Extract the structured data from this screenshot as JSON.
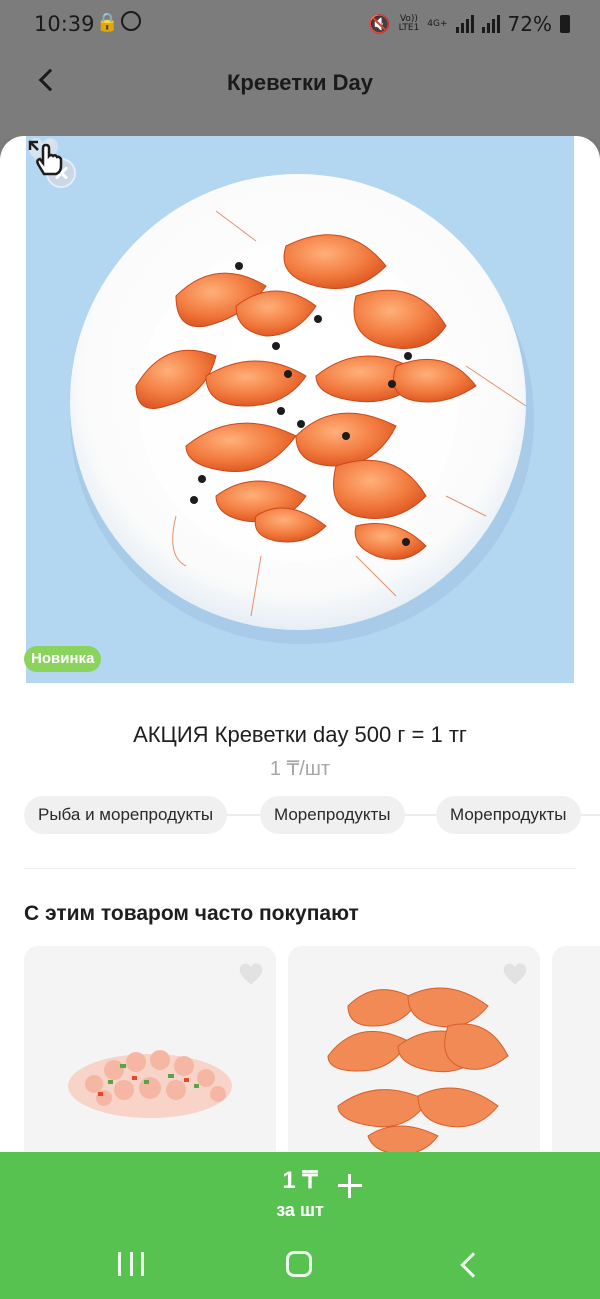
{
  "status_bar": {
    "time": "10:39",
    "network_volte": "Vo))",
    "network_lte": "LTE1",
    "network_4g": "4G+",
    "battery": "72%"
  },
  "header": {
    "title": "Креветки Day"
  },
  "product": {
    "badge": "Новинка",
    "name": "АКЦИЯ Креветки day 500 г = 1 тг",
    "price": "1 ₸/шт",
    "categories": [
      "Рыба и морепродукты",
      "Морепродукты",
      "Морепродукты"
    ]
  },
  "related": {
    "title": "С этим товаром часто покупают"
  },
  "cart": {
    "price": "1 ₸",
    "unit": "за шт"
  },
  "icons": {
    "back": "chevron-left-icon",
    "close": "close-icon",
    "share": "share-icon",
    "favorite": "heart-icon",
    "zoom": "tap-zoom-icon",
    "plus": "plus-icon"
  },
  "colors": {
    "accent": "#58c250",
    "badge": "#8bd35d",
    "hero_background": "#b3d6f1",
    "overlay": "#7c7c7c",
    "tag": "#f4c94a"
  }
}
